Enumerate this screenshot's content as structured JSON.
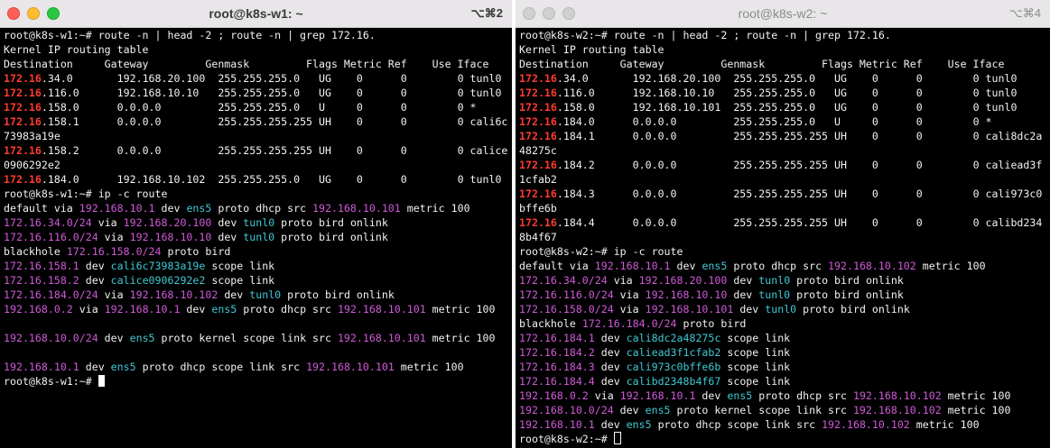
{
  "window1": {
    "title": "root@k8s-w1: ~",
    "shortcut": "⌥⌘2",
    "lines": [
      [
        [
          "root@k8s-w1:~# route -n | head -2 ; route -n | grep 172.16.",
          ""
        ]
      ],
      [
        [
          "Kernel IP routing table",
          ""
        ]
      ],
      [
        [
          "Destination     Gateway         Genmask         Flags Metric Ref    Use Iface",
          ""
        ]
      ],
      [
        [
          "172.16",
          "red"
        ],
        [
          ".34.0       192.168.20.100  255.255.255.0   UG    0      0        0 tunl0",
          ""
        ]
      ],
      [
        [
          "172.16",
          "red"
        ],
        [
          ".116.0      192.168.10.10   255.255.255.0   UG    0      0        0 tunl0",
          ""
        ]
      ],
      [
        [
          "172.16",
          "red"
        ],
        [
          ".158.0      0.0.0.0         255.255.255.0   U     0      0        0 *",
          ""
        ]
      ],
      [
        [
          "172.16",
          "red"
        ],
        [
          ".158.1      0.0.0.0         255.255.255.255 UH    0      0        0 cali6c",
          ""
        ]
      ],
      [
        [
          "73983a19e",
          ""
        ]
      ],
      [
        [
          "172.16",
          "red"
        ],
        [
          ".158.2      0.0.0.0         255.255.255.255 UH    0      0        0 calice",
          ""
        ]
      ],
      [
        [
          "0906292e2",
          ""
        ]
      ],
      [
        [
          "172.16",
          "red"
        ],
        [
          ".184.0      192.168.10.102  255.255.255.0   UG    0      0        0 tunl0",
          ""
        ]
      ],
      [
        [
          "root@k8s-w1:~# ip -c route",
          ""
        ]
      ],
      [
        [
          "default via ",
          ""
        ],
        [
          "192.168.10.1",
          "mg"
        ],
        [
          " dev ",
          ""
        ],
        [
          "ens5",
          "cy"
        ],
        [
          " proto dhcp src ",
          ""
        ],
        [
          "192.168.10.101",
          "mg"
        ],
        [
          " metric 100",
          ""
        ]
      ],
      [
        [
          "172.16.34.0/24",
          "mg"
        ],
        [
          " via ",
          ""
        ],
        [
          "192.168.20.100",
          "mg"
        ],
        [
          " dev ",
          ""
        ],
        [
          "tunl0",
          "cy"
        ],
        [
          " proto bird onlink",
          ""
        ]
      ],
      [
        [
          "172.16.116.0/24",
          "mg"
        ],
        [
          " via ",
          ""
        ],
        [
          "192.168.10.10",
          "mg"
        ],
        [
          " dev ",
          ""
        ],
        [
          "tunl0",
          "cy"
        ],
        [
          " proto bird onlink",
          ""
        ]
      ],
      [
        [
          "blackhole ",
          ""
        ],
        [
          "172.16.158.0/24",
          "mg"
        ],
        [
          " proto bird",
          ""
        ]
      ],
      [
        [
          "172.16.158.1",
          "mg"
        ],
        [
          " dev ",
          ""
        ],
        [
          "cali6c73983a19e",
          "cy"
        ],
        [
          " scope link",
          ""
        ]
      ],
      [
        [
          "172.16.158.2",
          "mg"
        ],
        [
          " dev ",
          ""
        ],
        [
          "calice0906292e2",
          "cy"
        ],
        [
          " scope link",
          ""
        ]
      ],
      [
        [
          "172.16.184.0/24",
          "mg"
        ],
        [
          " via ",
          ""
        ],
        [
          "192.168.10.102",
          "mg"
        ],
        [
          " dev ",
          ""
        ],
        [
          "tunl0",
          "cy"
        ],
        [
          " proto bird onlink",
          ""
        ]
      ],
      [
        [
          "192.168.0.2",
          "mg"
        ],
        [
          " via ",
          ""
        ],
        [
          "192.168.10.1",
          "mg"
        ],
        [
          " dev ",
          ""
        ],
        [
          "ens5",
          "cy"
        ],
        [
          " proto dhcp src ",
          ""
        ],
        [
          "192.168.10.101",
          "mg"
        ],
        [
          " metric 100",
          ""
        ]
      ],
      [],
      [
        [
          "192.168.10.0/24",
          "mg"
        ],
        [
          " dev ",
          ""
        ],
        [
          "ens5",
          "cy"
        ],
        [
          " proto kernel scope link src ",
          ""
        ],
        [
          "192.168.10.101",
          "mg"
        ],
        [
          " metric 100",
          ""
        ]
      ],
      [],
      [
        [
          "192.168.10.1",
          "mg"
        ],
        [
          " dev ",
          ""
        ],
        [
          "ens5",
          "cy"
        ],
        [
          " proto dhcp scope link src ",
          ""
        ],
        [
          "192.168.10.101",
          "mg"
        ],
        [
          " metric 100",
          ""
        ]
      ],
      [
        [
          "root@k8s-w1:~# ",
          ""
        ],
        [
          "",
          "cursor"
        ]
      ]
    ]
  },
  "window2": {
    "title": "root@k8s-w2: ~",
    "shortcut": "⌥⌘4",
    "lines": [
      [
        [
          "root@k8s-w2:~# route -n | head -2 ; route -n | grep 172.16.",
          ""
        ]
      ],
      [
        [
          "Kernel IP routing table",
          ""
        ]
      ],
      [
        [
          "Destination     Gateway         Genmask         Flags Metric Ref    Use Iface",
          ""
        ]
      ],
      [
        [
          "172.16",
          "red"
        ],
        [
          ".34.0       192.168.20.100  255.255.255.0   UG    0      0        0 tunl0",
          ""
        ]
      ],
      [
        [
          "172.16",
          "red"
        ],
        [
          ".116.0      192.168.10.10   255.255.255.0   UG    0      0        0 tunl0",
          ""
        ]
      ],
      [
        [
          "172.16",
          "red"
        ],
        [
          ".158.0      192.168.10.101  255.255.255.0   UG    0      0        0 tunl0",
          ""
        ]
      ],
      [
        [
          "172.16",
          "red"
        ],
        [
          ".184.0      0.0.0.0         255.255.255.0   U     0      0        0 *",
          ""
        ]
      ],
      [
        [
          "172.16",
          "red"
        ],
        [
          ".184.1      0.0.0.0         255.255.255.255 UH    0      0        0 cali8dc2a",
          ""
        ]
      ],
      [
        [
          "48275c",
          ""
        ]
      ],
      [
        [
          "172.16",
          "red"
        ],
        [
          ".184.2      0.0.0.0         255.255.255.255 UH    0      0        0 caliead3f",
          ""
        ]
      ],
      [
        [
          "1cfab2",
          ""
        ]
      ],
      [
        [
          "172.16",
          "red"
        ],
        [
          ".184.3      0.0.0.0         255.255.255.255 UH    0      0        0 cali973c0",
          ""
        ]
      ],
      [
        [
          "bffe6b",
          ""
        ]
      ],
      [
        [
          "172.16",
          "red"
        ],
        [
          ".184.4      0.0.0.0         255.255.255.255 UH    0      0        0 calibd234",
          ""
        ]
      ],
      [
        [
          "8b4f67",
          ""
        ]
      ],
      [
        [
          "root@k8s-w2:~# ip -c route",
          ""
        ]
      ],
      [
        [
          "default via ",
          ""
        ],
        [
          "192.168.10.1",
          "mg"
        ],
        [
          " dev ",
          ""
        ],
        [
          "ens5",
          "cy"
        ],
        [
          " proto dhcp src ",
          ""
        ],
        [
          "192.168.10.102",
          "mg"
        ],
        [
          " metric 100",
          ""
        ]
      ],
      [
        [
          "172.16.34.0/24",
          "mg"
        ],
        [
          " via ",
          ""
        ],
        [
          "192.168.20.100",
          "mg"
        ],
        [
          " dev ",
          ""
        ],
        [
          "tunl0",
          "cy"
        ],
        [
          " proto bird onlink",
          ""
        ]
      ],
      [
        [
          "172.16.116.0/24",
          "mg"
        ],
        [
          " via ",
          ""
        ],
        [
          "192.168.10.10",
          "mg"
        ],
        [
          " dev ",
          ""
        ],
        [
          "tunl0",
          "cy"
        ],
        [
          " proto bird onlink",
          ""
        ]
      ],
      [
        [
          "172.16.158.0/24",
          "mg"
        ],
        [
          " via ",
          ""
        ],
        [
          "192.168.10.101",
          "mg"
        ],
        [
          " dev ",
          ""
        ],
        [
          "tunl0",
          "cy"
        ],
        [
          " proto bird onlink",
          ""
        ]
      ],
      [
        [
          "blackhole ",
          ""
        ],
        [
          "172.16.184.0/24",
          "mg"
        ],
        [
          " proto bird",
          ""
        ]
      ],
      [
        [
          "172.16.184.1",
          "mg"
        ],
        [
          " dev ",
          ""
        ],
        [
          "cali8dc2a48275c",
          "cy"
        ],
        [
          " scope link",
          ""
        ]
      ],
      [
        [
          "172.16.184.2",
          "mg"
        ],
        [
          " dev ",
          ""
        ],
        [
          "caliead3f1cfab2",
          "cy"
        ],
        [
          " scope link",
          ""
        ]
      ],
      [
        [
          "172.16.184.3",
          "mg"
        ],
        [
          " dev ",
          ""
        ],
        [
          "cali973c0bffe6b",
          "cy"
        ],
        [
          " scope link",
          ""
        ]
      ],
      [
        [
          "172.16.184.4",
          "mg"
        ],
        [
          " dev ",
          ""
        ],
        [
          "calibd2348b4f67",
          "cy"
        ],
        [
          " scope link",
          ""
        ]
      ],
      [
        [
          "192.168.0.2",
          "mg"
        ],
        [
          " via ",
          ""
        ],
        [
          "192.168.10.1",
          "mg"
        ],
        [
          " dev ",
          ""
        ],
        [
          "ens5",
          "cy"
        ],
        [
          " proto dhcp src ",
          ""
        ],
        [
          "192.168.10.102",
          "mg"
        ],
        [
          " metric 100",
          ""
        ]
      ],
      [
        [
          "192.168.10.0/24",
          "mg"
        ],
        [
          " dev ",
          ""
        ],
        [
          "ens5",
          "cy"
        ],
        [
          " proto kernel scope link src ",
          ""
        ],
        [
          "192.168.10.102",
          "mg"
        ],
        [
          " metric 100",
          ""
        ]
      ],
      [
        [
          "192.168.10.1",
          "mg"
        ],
        [
          " dev ",
          ""
        ],
        [
          "ens5",
          "cy"
        ],
        [
          " proto dhcp scope link src ",
          ""
        ],
        [
          "192.168.10.102",
          "mg"
        ],
        [
          " metric 100",
          ""
        ]
      ],
      [
        [
          "root@k8s-w2:~# ",
          ""
        ],
        [
          "",
          "cursor hollow"
        ]
      ]
    ]
  },
  "colors": {
    "red": "#ff3b30",
    "cyan": "#3fc9d4",
    "magenta": "#d05ad8",
    "background": "#000000",
    "text": "#f2f2f2"
  }
}
